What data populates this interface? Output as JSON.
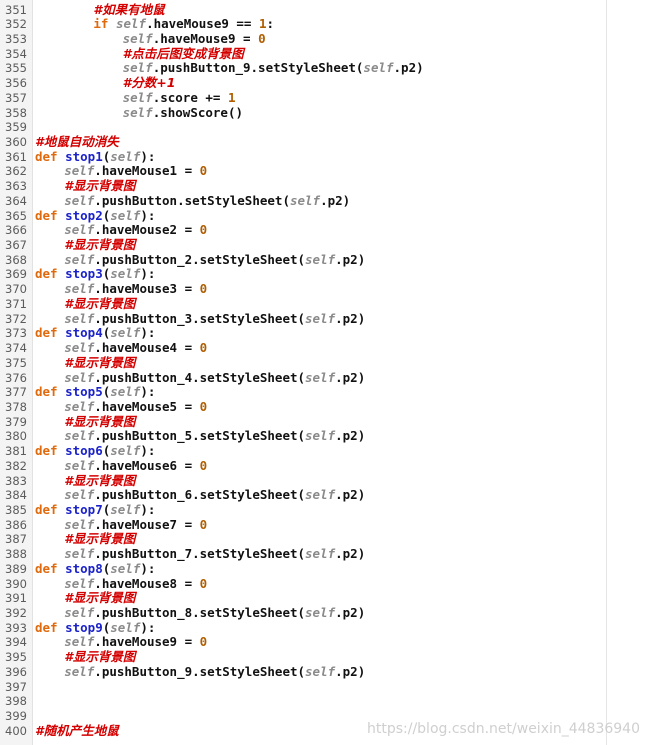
{
  "editor": {
    "lines": [
      {
        "n": "351",
        "indent": 2,
        "t": [
          [
            "cm",
            "#如果有地鼠"
          ]
        ]
      },
      {
        "n": "352",
        "indent": 2,
        "t": [
          [
            "kw",
            "if "
          ],
          [
            "sf",
            "self"
          ],
          [
            "",
            "."
          ],
          [
            "",
            "haveMouse9 == "
          ],
          [
            "nm",
            "1"
          ],
          [
            "",
            ":"
          ]
        ]
      },
      {
        "n": "353",
        "indent": 3,
        "t": [
          [
            "sf",
            "self"
          ],
          [
            "",
            ".haveMouse9 = "
          ],
          [
            "nm",
            "0"
          ]
        ]
      },
      {
        "n": "354",
        "indent": 3,
        "t": [
          [
            "cm",
            "#点击后图变成背景图"
          ]
        ]
      },
      {
        "n": "355",
        "indent": 3,
        "t": [
          [
            "sf",
            "self"
          ],
          [
            "",
            ".pushButton_9.setStyleSheet("
          ],
          [
            "sf",
            "self"
          ],
          [
            "",
            ".p2)"
          ]
        ]
      },
      {
        "n": "356",
        "indent": 3,
        "t": [
          [
            "cm",
            "#分数+1"
          ]
        ]
      },
      {
        "n": "357",
        "indent": 3,
        "t": [
          [
            "sf",
            "self"
          ],
          [
            "",
            ".score += "
          ],
          [
            "nm",
            "1"
          ]
        ]
      },
      {
        "n": "358",
        "indent": 3,
        "t": [
          [
            "sf",
            "self"
          ],
          [
            "",
            ".showScore()"
          ]
        ]
      },
      {
        "n": "359",
        "indent": 0,
        "t": []
      },
      {
        "n": "360",
        "indent": 0,
        "t": [
          [
            "cm",
            "#地鼠自动消失"
          ]
        ]
      },
      {
        "n": "361",
        "indent": 0,
        "t": [
          [
            "kw",
            "def "
          ],
          [
            "fn",
            "stop1"
          ],
          [
            "",
            "("
          ],
          [
            "sf",
            "self"
          ],
          [
            "",
            "):"
          ]
        ]
      },
      {
        "n": "362",
        "indent": 1,
        "t": [
          [
            "sf",
            "self"
          ],
          [
            "",
            ".haveMouse1 = "
          ],
          [
            "nm",
            "0"
          ]
        ]
      },
      {
        "n": "363",
        "indent": 1,
        "t": [
          [
            "cm",
            "#显示背景图"
          ]
        ]
      },
      {
        "n": "364",
        "indent": 1,
        "t": [
          [
            "sf",
            "self"
          ],
          [
            "",
            ".pushButton.setStyleSheet("
          ],
          [
            "sf",
            "self"
          ],
          [
            "",
            ".p2)"
          ]
        ]
      },
      {
        "n": "365",
        "indent": 0,
        "t": [
          [
            "kw",
            "def "
          ],
          [
            "fn",
            "stop2"
          ],
          [
            "",
            "("
          ],
          [
            "sf",
            "self"
          ],
          [
            "",
            "):"
          ]
        ]
      },
      {
        "n": "366",
        "indent": 1,
        "t": [
          [
            "sf",
            "self"
          ],
          [
            "",
            ".haveMouse2 = "
          ],
          [
            "nm",
            "0"
          ]
        ]
      },
      {
        "n": "367",
        "indent": 1,
        "t": [
          [
            "cm",
            "#显示背景图"
          ]
        ]
      },
      {
        "n": "368",
        "indent": 1,
        "t": [
          [
            "sf",
            "self"
          ],
          [
            "",
            ".pushButton_2.setStyleSheet("
          ],
          [
            "sf",
            "self"
          ],
          [
            "",
            ".p2)"
          ]
        ]
      },
      {
        "n": "369",
        "indent": 0,
        "t": [
          [
            "kw",
            "def "
          ],
          [
            "fn",
            "stop3"
          ],
          [
            "",
            "("
          ],
          [
            "sf",
            "self"
          ],
          [
            "",
            "):"
          ]
        ]
      },
      {
        "n": "370",
        "indent": 1,
        "t": [
          [
            "sf",
            "self"
          ],
          [
            "",
            ".haveMouse3 = "
          ],
          [
            "nm",
            "0"
          ]
        ]
      },
      {
        "n": "371",
        "indent": 1,
        "t": [
          [
            "cm",
            "#显示背景图"
          ]
        ]
      },
      {
        "n": "372",
        "indent": 1,
        "t": [
          [
            "sf",
            "self"
          ],
          [
            "",
            ".pushButton_3.setStyleSheet("
          ],
          [
            "sf",
            "self"
          ],
          [
            "",
            ".p2)"
          ]
        ]
      },
      {
        "n": "373",
        "indent": 0,
        "t": [
          [
            "kw",
            "def "
          ],
          [
            "fn",
            "stop4"
          ],
          [
            "",
            "("
          ],
          [
            "sf",
            "self"
          ],
          [
            "",
            "):"
          ]
        ]
      },
      {
        "n": "374",
        "indent": 1,
        "t": [
          [
            "sf",
            "self"
          ],
          [
            "",
            ".haveMouse4 = "
          ],
          [
            "nm",
            "0"
          ]
        ]
      },
      {
        "n": "375",
        "indent": 1,
        "t": [
          [
            "cm",
            "#显示背景图"
          ]
        ]
      },
      {
        "n": "376",
        "indent": 1,
        "t": [
          [
            "sf",
            "self"
          ],
          [
            "",
            ".pushButton_4.setStyleSheet("
          ],
          [
            "sf",
            "self"
          ],
          [
            "",
            ".p2)"
          ]
        ]
      },
      {
        "n": "377",
        "indent": 0,
        "t": [
          [
            "kw",
            "def "
          ],
          [
            "fn",
            "stop5"
          ],
          [
            "",
            "("
          ],
          [
            "sf",
            "self"
          ],
          [
            "",
            "):"
          ]
        ]
      },
      {
        "n": "378",
        "indent": 1,
        "t": [
          [
            "sf",
            "self"
          ],
          [
            "",
            ".haveMouse5 = "
          ],
          [
            "nm",
            "0"
          ]
        ]
      },
      {
        "n": "379",
        "indent": 1,
        "t": [
          [
            "cm",
            "#显示背景图"
          ]
        ]
      },
      {
        "n": "380",
        "indent": 1,
        "t": [
          [
            "sf",
            "self"
          ],
          [
            "",
            ".pushButton_5.setStyleSheet("
          ],
          [
            "sf",
            "self"
          ],
          [
            "",
            ".p2)"
          ]
        ]
      },
      {
        "n": "381",
        "indent": 0,
        "t": [
          [
            "kw",
            "def "
          ],
          [
            "fn",
            "stop6"
          ],
          [
            "",
            "("
          ],
          [
            "sf",
            "self"
          ],
          [
            "",
            "):"
          ]
        ]
      },
      {
        "n": "382",
        "indent": 1,
        "t": [
          [
            "sf",
            "self"
          ],
          [
            "",
            ".haveMouse6 = "
          ],
          [
            "nm",
            "0"
          ]
        ]
      },
      {
        "n": "383",
        "indent": 1,
        "t": [
          [
            "cm",
            "#显示背景图"
          ]
        ]
      },
      {
        "n": "384",
        "indent": 1,
        "t": [
          [
            "sf",
            "self"
          ],
          [
            "",
            ".pushButton_6.setStyleSheet("
          ],
          [
            "sf",
            "self"
          ],
          [
            "",
            ".p2)"
          ]
        ]
      },
      {
        "n": "385",
        "indent": 0,
        "t": [
          [
            "kw",
            "def "
          ],
          [
            "fn",
            "stop7"
          ],
          [
            "",
            "("
          ],
          [
            "sf",
            "self"
          ],
          [
            "",
            "):"
          ]
        ]
      },
      {
        "n": "386",
        "indent": 1,
        "t": [
          [
            "sf",
            "self"
          ],
          [
            "",
            ".haveMouse7 = "
          ],
          [
            "nm",
            "0"
          ]
        ]
      },
      {
        "n": "387",
        "indent": 1,
        "t": [
          [
            "cm",
            "#显示背景图"
          ]
        ]
      },
      {
        "n": "388",
        "indent": 1,
        "t": [
          [
            "sf",
            "self"
          ],
          [
            "",
            ".pushButton_7.setStyleSheet("
          ],
          [
            "sf",
            "self"
          ],
          [
            "",
            ".p2)"
          ]
        ]
      },
      {
        "n": "389",
        "indent": 0,
        "t": [
          [
            "kw",
            "def "
          ],
          [
            "fn",
            "stop8"
          ],
          [
            "",
            "("
          ],
          [
            "sf",
            "self"
          ],
          [
            "",
            "):"
          ]
        ]
      },
      {
        "n": "390",
        "indent": 1,
        "t": [
          [
            "sf",
            "self"
          ],
          [
            "",
            ".haveMouse8 = "
          ],
          [
            "nm",
            "0"
          ]
        ]
      },
      {
        "n": "391",
        "indent": 1,
        "t": [
          [
            "cm",
            "#显示背景图"
          ]
        ]
      },
      {
        "n": "392",
        "indent": 1,
        "t": [
          [
            "sf",
            "self"
          ],
          [
            "",
            ".pushButton_8.setStyleSheet("
          ],
          [
            "sf",
            "self"
          ],
          [
            "",
            ".p2)"
          ]
        ]
      },
      {
        "n": "393",
        "indent": 0,
        "t": [
          [
            "kw",
            "def "
          ],
          [
            "fn",
            "stop9"
          ],
          [
            "",
            "("
          ],
          [
            "sf",
            "self"
          ],
          [
            "",
            "):"
          ]
        ]
      },
      {
        "n": "394",
        "indent": 1,
        "t": [
          [
            "sf",
            "self"
          ],
          [
            "",
            ".haveMouse9 = "
          ],
          [
            "nm",
            "0"
          ]
        ]
      },
      {
        "n": "395",
        "indent": 1,
        "t": [
          [
            "cm",
            "#显示背景图"
          ]
        ]
      },
      {
        "n": "396",
        "indent": 1,
        "t": [
          [
            "sf",
            "self"
          ],
          [
            "",
            ".pushButton_9.setStyleSheet("
          ],
          [
            "sf",
            "self"
          ],
          [
            "",
            ".p2)"
          ]
        ]
      },
      {
        "n": "397",
        "indent": 0,
        "t": []
      },
      {
        "n": "398",
        "indent": 0,
        "t": []
      },
      {
        "n": "399",
        "indent": 0,
        "t": []
      },
      {
        "n": "400",
        "indent": 0,
        "t": [
          [
            "cm",
            "#随机产生地鼠"
          ]
        ]
      }
    ]
  },
  "watermark": "https://blog.csdn.net/weixin_44836940",
  "colors": {
    "keyword": "#e0690c",
    "self": "#8a8a8a",
    "function_name": "#1b22c8",
    "number": "#b05e00",
    "comment": "#d40000",
    "gutter_bg": "#f4f4f4"
  }
}
